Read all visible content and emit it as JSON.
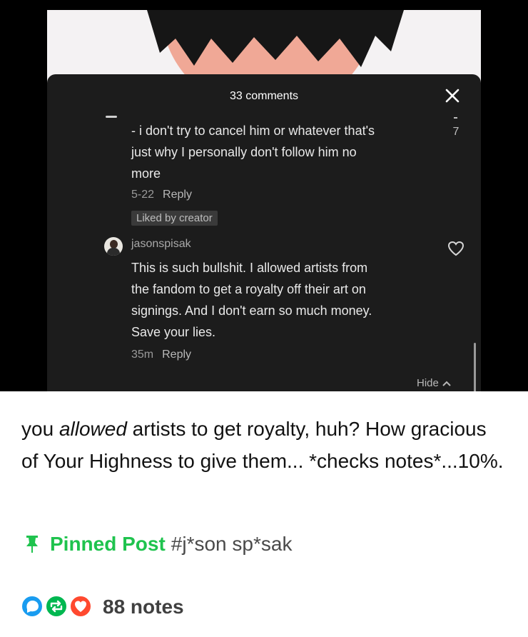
{
  "screenshot": {
    "title": "33 comments",
    "side_count": "7",
    "comment_1": {
      "lines": [
        "- i don't try to cancel him or whatever that's",
        "just why I personally don't follow him no",
        "more"
      ],
      "date": "5-22",
      "reply_label": "Reply",
      "badge": "Liked by creator"
    },
    "comment_2": {
      "username": "jasonspisak",
      "lines": [
        "This is such bullshit. I allowed artists from",
        "the fandom to get a royalty off their art on",
        "signings. And I don't earn so much money.",
        "Save your lies."
      ],
      "time": "35m",
      "reply_label": "Reply"
    },
    "hide_label": "Hide",
    "colors": {
      "panel": "#1c1c1c",
      "face": "#f0a896"
    }
  },
  "post": {
    "text_before": "you ",
    "text_emphasis": "allowed",
    "text_after": " artists to get royalty, huh? How gracious of Your Highness to give them... *checks notes*...10%.",
    "pinned_label": "Pinned Post",
    "tag": "#j*son sp*sak",
    "notes_count": "88 notes",
    "icons": [
      "reply-bubble-icon",
      "reblog-icon",
      "like-heart-icon"
    ],
    "colors": {
      "pinned": "#1fc34e",
      "reply": "#199cf0",
      "reblog": "#00b750",
      "like": "#ff492f"
    }
  }
}
